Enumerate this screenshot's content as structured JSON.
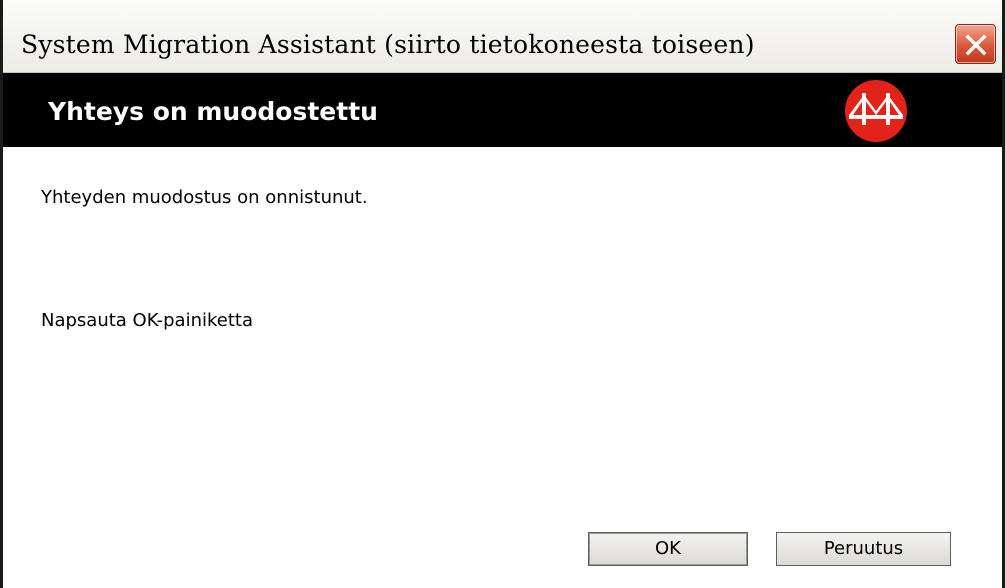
{
  "window": {
    "title": "System Migration Assistant (siirto tietokoneesta toiseen)"
  },
  "banner": {
    "title": "Yhteys on muodostettu",
    "logo_icon": "bridge-logo-icon",
    "logo_color": "#e2231a"
  },
  "content": {
    "status_message": "Yhteyden muodostus on onnistunut.",
    "instruction": "Napsauta OK-painiketta"
  },
  "buttons": {
    "ok_label": "OK",
    "cancel_label": "Peruutus"
  },
  "titlebar_controls": {
    "close_icon": "close-icon",
    "close_color": "#d9573a"
  }
}
